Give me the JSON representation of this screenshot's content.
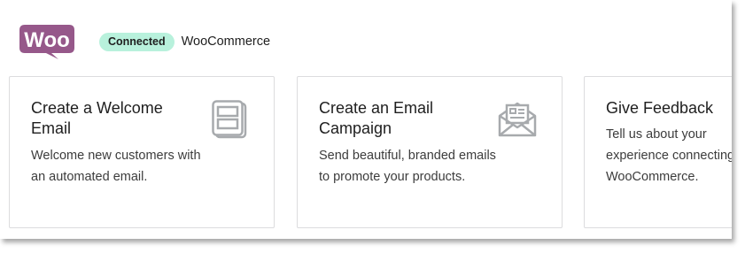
{
  "header": {
    "logo_text": "Woo",
    "status_badge": "Connected",
    "brand_name": "WooCommerce"
  },
  "cards": [
    {
      "title": "Create a Welcome Email",
      "description": "Welcome new customers with an automated email.",
      "icon": "newsletter-icon"
    },
    {
      "title": "Create an Email Campaign",
      "description": "Send beautiful, branded emails to promote your products.",
      "icon": "envelope-icon"
    },
    {
      "title": "Give Feedback",
      "description": "Tell us about your experience connecting WooCommerce."
    }
  ],
  "colors": {
    "woo_purple": "#96588a",
    "badge_bg": "#b8f1dc",
    "icon_gray": "#a7aaad"
  }
}
